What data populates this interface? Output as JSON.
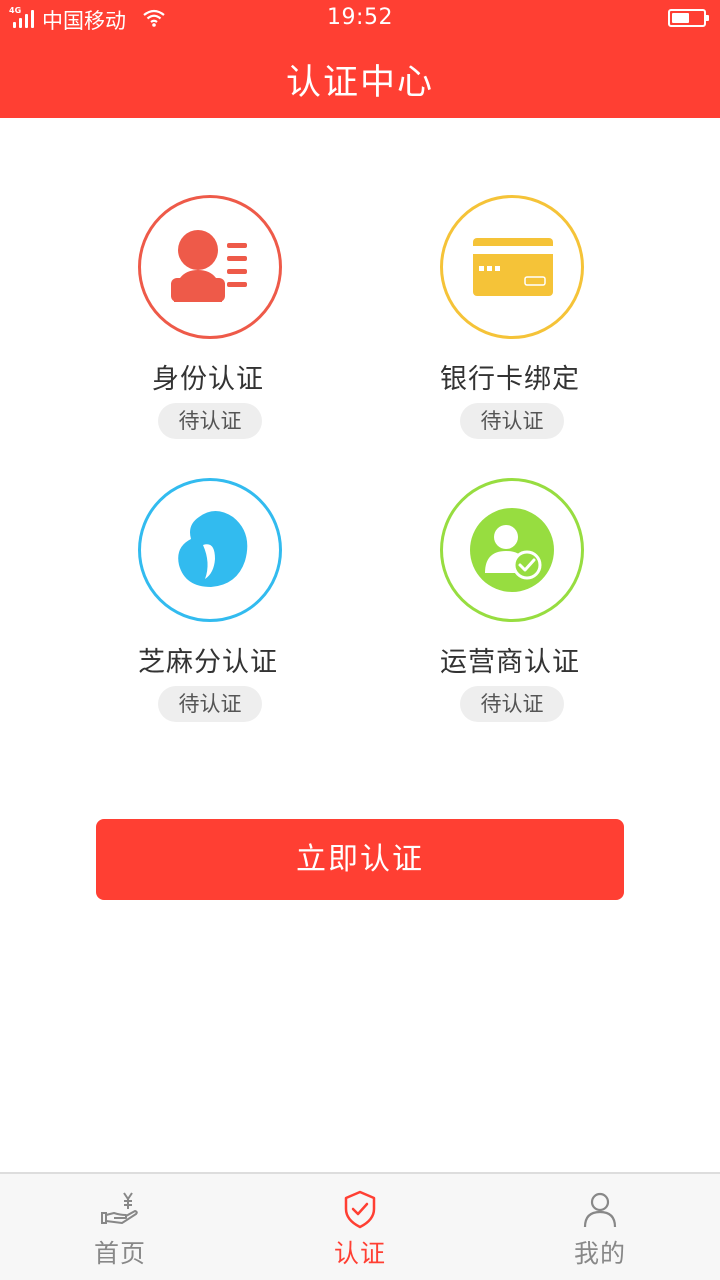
{
  "status_bar": {
    "network": "4G",
    "carrier": "中国移动",
    "time": "19:52",
    "battery_level": 0.55
  },
  "header": {
    "title": "认证中心"
  },
  "items": [
    {
      "label": "身份认证",
      "status": "待认证",
      "icon": "id-card-person-icon",
      "color": "#ee5a49"
    },
    {
      "label": "银行卡绑定",
      "status": "待认证",
      "icon": "bank-card-icon",
      "color": "#f5c338"
    },
    {
      "label": "芝麻分认证",
      "status": "待认证",
      "icon": "sesame-drop-icon",
      "color": "#32bbef"
    },
    {
      "label": "运营商认证",
      "status": "待认证",
      "icon": "user-verified-icon",
      "color": "#97dd40"
    }
  ],
  "cta": {
    "label": "立即认证"
  },
  "tabbar": {
    "tabs": [
      {
        "label": "首页",
        "icon": "hand-yen-icon",
        "active": false
      },
      {
        "label": "认证",
        "icon": "shield-check-icon",
        "active": true
      },
      {
        "label": "我的",
        "icon": "user-icon",
        "active": false
      }
    ],
    "active_color": "#ff3f33",
    "inactive_color": "#888888"
  }
}
